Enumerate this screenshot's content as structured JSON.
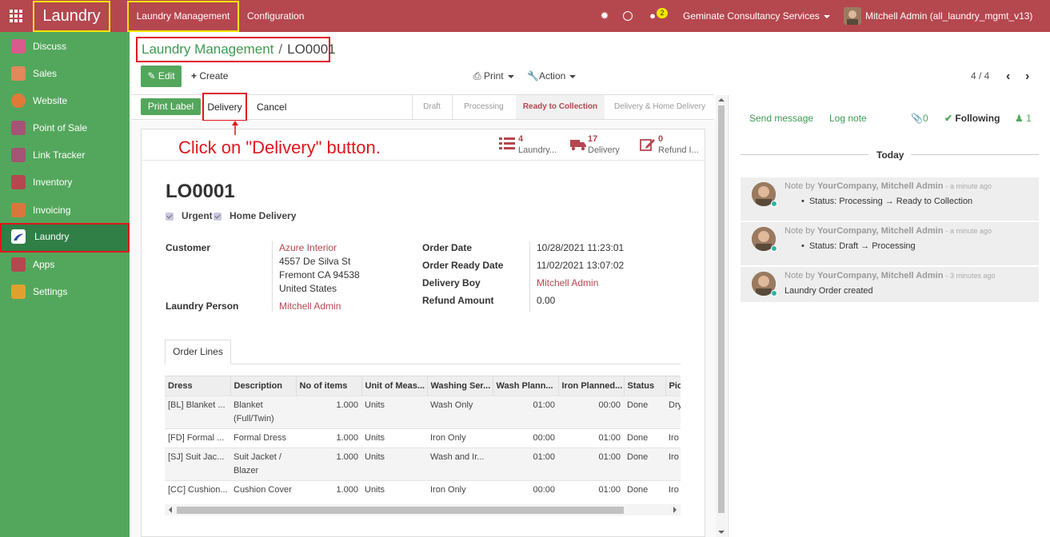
{
  "topbar": {
    "brand": "Laundry",
    "menu_main": "Laundry Management",
    "menu_config": "Configuration",
    "chat_count": "2",
    "company": "Geminate Consultancy Services",
    "user": "Mitchell Admin (all_laundry_mgmt_v13)"
  },
  "sidebar": {
    "items": [
      {
        "label": "Discuss",
        "color": "#d95a8c"
      },
      {
        "label": "Sales",
        "color": "#e2885a"
      },
      {
        "label": "Website",
        "color": "#e07a38"
      },
      {
        "label": "Point of Sale",
        "color": "#a45474"
      },
      {
        "label": "Link Tracker",
        "color": "#a45474"
      },
      {
        "label": "Inventory",
        "color": "#b5474f"
      },
      {
        "label": "Invoicing",
        "color": "#d9763c"
      },
      {
        "label": "Laundry",
        "color": "#ffffff"
      },
      {
        "label": "Apps",
        "color": "#b5474f"
      },
      {
        "label": "Settings",
        "color": "#e0a030"
      }
    ]
  },
  "breadcrumb": {
    "parent": "Laundry Management",
    "separator": "/",
    "current": "LO0001"
  },
  "controls": {
    "edit": "Edit",
    "create": "Create",
    "print": "Print",
    "action": "Action",
    "pager": "4 / 4"
  },
  "statusbar": {
    "print_label": "Print Label",
    "delivery": "Delivery",
    "cancel": "Cancel",
    "stages": [
      "Draft",
      "Processing",
      "Ready to Collection",
      "Delivery & Home Delivery"
    ],
    "current_stage": "Ready to Collection"
  },
  "annotation": "Click on \"Delivery\" button.",
  "smart_buttons": [
    {
      "count": "4",
      "label": "Laundry..."
    },
    {
      "count": "17",
      "label": "Delivery"
    },
    {
      "count": "0",
      "label": "Refund I..."
    }
  ],
  "record": {
    "name": "LO0001",
    "urgent": "Urgent",
    "home_delivery": "Home Delivery",
    "customer_label": "Customer",
    "customer_name": "Azure Interior",
    "address": [
      "4557 De Silva St",
      "Fremont CA 94538",
      "United States"
    ],
    "laundry_person_label": "Laundry Person",
    "laundry_person": "Mitchell Admin",
    "order_date_label": "Order Date",
    "order_date": "10/28/2021 11:23:01",
    "ready_date_label": "Order Ready Date",
    "ready_date": "11/02/2021 13:07:02",
    "delivery_boy_label": "Delivery Boy",
    "delivery_boy": "Mitchell Admin",
    "refund_label": "Refund Amount",
    "refund": "0.00"
  },
  "tab": "Order Lines",
  "order_lines": {
    "headers": [
      "Dress",
      "Description",
      "No of items",
      "Unit of Meas...",
      "Washing Ser...",
      "Wash Plann...",
      "Iron Planned...",
      "Status",
      "Pic"
    ],
    "rows": [
      [
        "[BL] Blanket ...",
        "Blanket (Full/Twin)",
        "1.000",
        "Units",
        "Wash Only",
        "01:00",
        "00:00",
        "Done",
        "Dry"
      ],
      [
        "[FD] Formal ...",
        "Formal Dress",
        "1.000",
        "Units",
        "Iron Only",
        "00:00",
        "01:00",
        "Done",
        "Iro"
      ],
      [
        "[SJ] Suit Jac...",
        "Suit Jacket / Blazer",
        "1.000",
        "Units",
        "Wash and Ir...",
        "01:00",
        "01:00",
        "Done",
        "Iro"
      ],
      [
        "[CC] Cushion...",
        "Cushion Cover",
        "1.000",
        "Units",
        "Iron Only",
        "00:00",
        "01:00",
        "Done",
        "Iro"
      ]
    ]
  },
  "chatter": {
    "send_message": "Send message",
    "log_note": "Log note",
    "attachments": "0",
    "following": "Following",
    "followers": "1",
    "today": "Today",
    "messages": [
      {
        "prefix": "Note by",
        "author": "YourCompany, Mitchell Admin",
        "time": "- a minute ago",
        "body": "Status: Processing → Ready to Collection"
      },
      {
        "prefix": "Note by",
        "author": "YourCompany, Mitchell Admin",
        "time": "- a minute ago",
        "body": "Status: Draft → Processing"
      },
      {
        "prefix": "Note by",
        "author": "YourCompany, Mitchell Admin",
        "time": "- 3 minutes ago",
        "body": "Laundry Order created"
      }
    ]
  }
}
